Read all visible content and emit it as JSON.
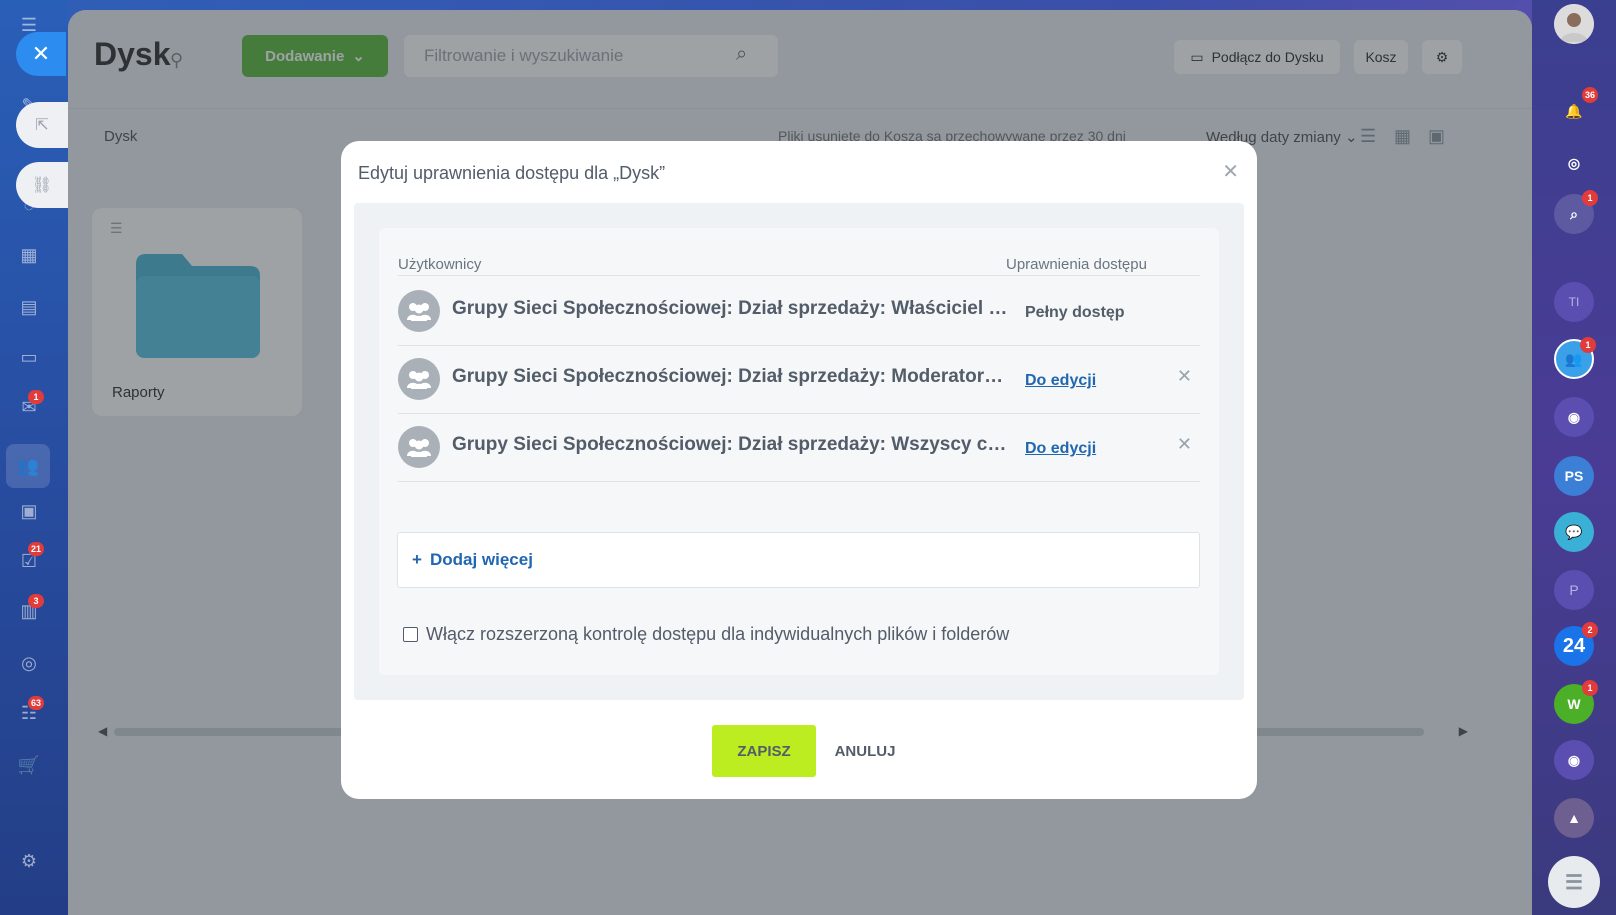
{
  "left_rail": {
    "badges": {
      "mail": "1",
      "tasks": "21",
      "news": "3",
      "funnel": "63"
    }
  },
  "header": {
    "title": "Dysk",
    "add_label": "Dodawanie",
    "search_placeholder": "Filtrowanie i wyszukiwanie",
    "connect_label": "Podłącz do Dysku",
    "trash_label": "Kosz"
  },
  "toolbar": {
    "breadcrumb": "Dysk",
    "retention_note": "Pliki usunięte do Kosza są przechowywane przez 30 dni",
    "sort_label": "Według daty zmiany"
  },
  "files": [
    {
      "name": "Raporty"
    }
  ],
  "right_rail": {
    "notifications_badge": "36",
    "chat_badge": "1",
    "group_badge": "1",
    "b24_badge": "2",
    "w_badge": "1",
    "ps_label": "PS",
    "p_label": "P",
    "ti_label": "TI",
    "w_label": "W",
    "b24_label": "24"
  },
  "modal": {
    "title": "Edytuj uprawnienia dostępu dla „Dysk”",
    "col_users": "Użytkownicy",
    "col_access": "Uprawnienia dostępu",
    "rows": [
      {
        "name": "Grupy Sieci Społecznościowej: Dział sprzedaży: Właściciel grupy",
        "access": "Pełny dostęp"
      },
      {
        "name": "Grupy Sieci Społecznościowej: Dział sprzedaży: Moderatorzy grupy",
        "access": "Do edycji"
      },
      {
        "name": "Grupy Sieci Społecznościowej: Dział sprzedaży: Wszyscy członkowie grupy",
        "access": "Do edycji"
      }
    ],
    "add_more": "Dodaj więcej",
    "extended_control": "Włącz rozszerzoną kontrolę dostępu dla indywidualnych plików i folderów",
    "save": "ZAPISZ",
    "cancel": "ANULUJ"
  },
  "colors": {
    "save_button": "#bbed21",
    "add_button": "#5dbb3f",
    "link": "#2067b0"
  }
}
